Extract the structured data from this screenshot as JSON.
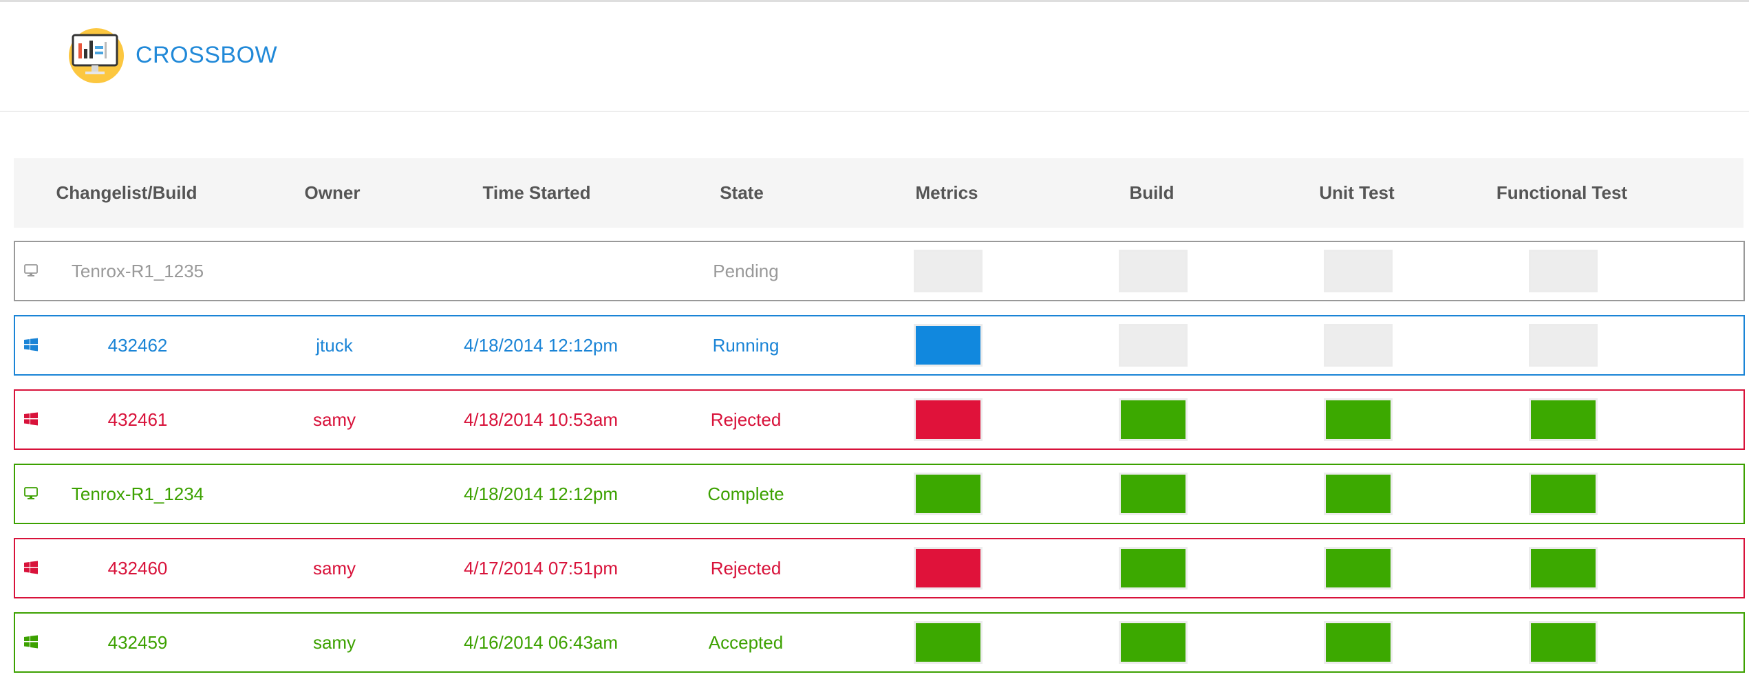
{
  "app": {
    "name": "CROSSBOW"
  },
  "colors": {
    "pending": "#999999",
    "running": "#1a84d6",
    "rejected": "#d8123a",
    "complete": "#3ca100",
    "box_blue": "#1188de",
    "box_red": "#e0123a",
    "box_green": "#3ca900",
    "box_empty": "#ededed"
  },
  "table": {
    "headers": [
      "Changelist/Build",
      "Owner",
      "Time Started",
      "State",
      "Metrics",
      "Build",
      "Unit Test",
      "Functional Test"
    ],
    "rows": [
      {
        "icon": "monitor-icon",
        "status": "pending",
        "changelist": "Tenrox-R1_1235",
        "owner": "",
        "time_started": "",
        "state": "Pending",
        "stages": {
          "metrics": "empty",
          "build": "empty",
          "unit_test": "empty",
          "functional_test": "empty"
        }
      },
      {
        "icon": "windows-icon",
        "status": "running",
        "changelist": "432462",
        "owner": "jtuck",
        "time_started": "4/18/2014 12:12pm",
        "state": "Running",
        "stages": {
          "metrics": "blue",
          "build": "empty",
          "unit_test": "empty",
          "functional_test": "empty"
        }
      },
      {
        "icon": "windows-icon",
        "status": "rejected",
        "changelist": "432461",
        "owner": "samy",
        "time_started": "4/18/2014 10:53am",
        "state": "Rejected",
        "stages": {
          "metrics": "red",
          "build": "green",
          "unit_test": "green",
          "functional_test": "green"
        }
      },
      {
        "icon": "monitor-icon",
        "status": "complete",
        "changelist": "Tenrox-R1_1234",
        "owner": "",
        "time_started": "4/18/2014 12:12pm",
        "state": "Complete",
        "stages": {
          "metrics": "green",
          "build": "green",
          "unit_test": "green",
          "functional_test": "green"
        }
      },
      {
        "icon": "windows-icon",
        "status": "rejected",
        "changelist": "432460",
        "owner": "samy",
        "time_started": "4/17/2014 07:51pm",
        "state": "Rejected",
        "stages": {
          "metrics": "red",
          "build": "green",
          "unit_test": "green",
          "functional_test": "green"
        }
      },
      {
        "icon": "windows-icon",
        "status": "complete",
        "changelist": "432459",
        "owner": "samy",
        "time_started": "4/16/2014 06:43am",
        "state": "Accepted",
        "stages": {
          "metrics": "green",
          "build": "green",
          "unit_test": "green",
          "functional_test": "green"
        }
      }
    ]
  }
}
